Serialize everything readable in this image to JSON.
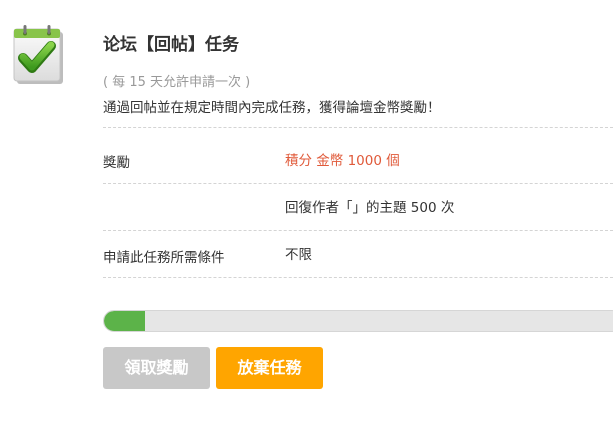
{
  "task": {
    "title": "论坛【回帖】任务",
    "interval": "( 每 15 天允許申請一次 )",
    "description": "通過回帖並在規定時間內完成任務，獲得論壇金幣獎勵！",
    "icon": "task-clipboard-check-icon"
  },
  "details": {
    "reward_label": "獎勵",
    "reward_value": "積分 金幣 1000 個",
    "requirement_value": "回復作者「」的主題 500 次",
    "condition_label": "申請此任務所需條件",
    "condition_value": "不限"
  },
  "progress": {
    "fraction": 0.08
  },
  "buttons": {
    "claim_label": "領取獎勵",
    "abandon_label": "放棄任務"
  },
  "colors": {
    "reward_text": "#e05a3a",
    "progress_fill": "#5cb349",
    "claim_disabled": "#c8c8c8",
    "abandon_accent": "#ffa500"
  }
}
